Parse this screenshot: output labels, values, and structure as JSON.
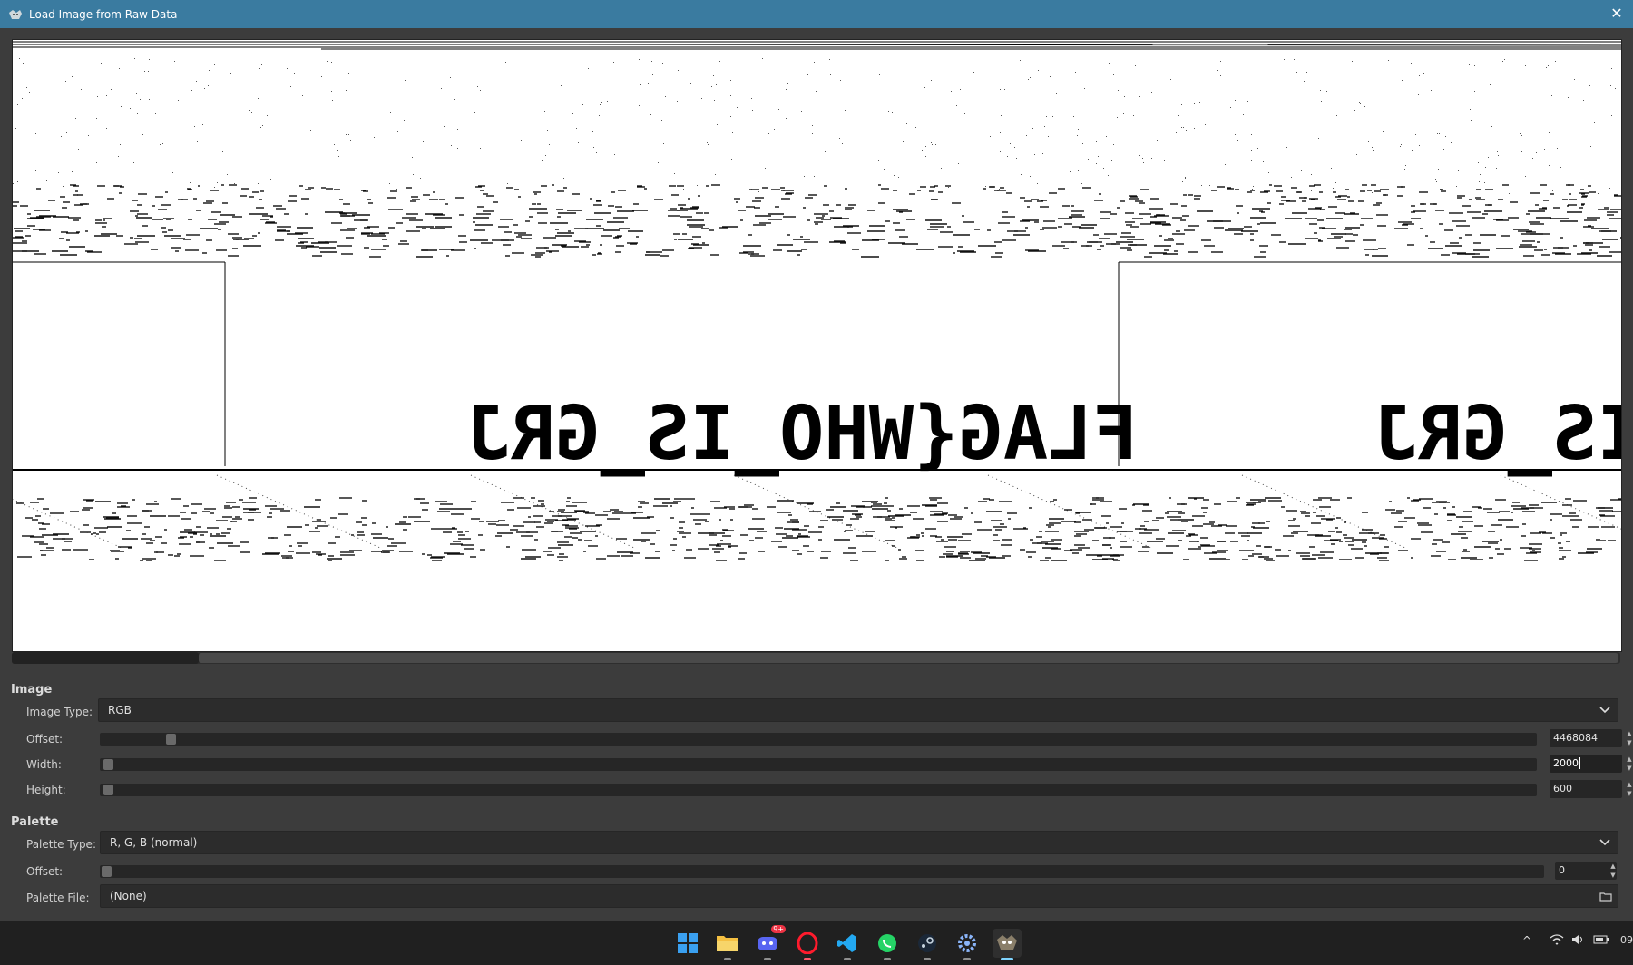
{
  "window": {
    "title": "Load Image from Raw Data",
    "close_glyph": "✕"
  },
  "preview": {
    "visible_text": "FLAG{WHO_IS_GRJ",
    "text_rendering": "mirrored garbled raw pixel data"
  },
  "image_section": {
    "heading": "Image",
    "image_type_label": "Image Type:",
    "image_type_value": "RGB",
    "offset_label": "Offset:",
    "offset_value": "4468084",
    "offset_level": 0.045,
    "width_label": "Width:",
    "width_value": "2000",
    "width_level": 0.001,
    "height_label": "Height:",
    "height_value": "600",
    "height_level": 0.001
  },
  "palette_section": {
    "heading": "Palette",
    "palette_type_label": "Palette Type:",
    "palette_type_value": "R, G, B (normal)",
    "offset_label": "Offset:",
    "offset_value": "0",
    "offset_level": 0.0,
    "palette_file_label": "Palette File:",
    "palette_file_value": "(None)"
  },
  "taskbar": {
    "apps": [
      "windows-start",
      "file-explorer",
      "discord",
      "opera",
      "vscode",
      "whatsapp",
      "steam",
      "settings",
      "gimp"
    ],
    "discord_badge": "9+",
    "clock_partial": "09"
  },
  "colors": {
    "titlebar": "#3a7ba0",
    "dialog_bg": "#3c3c3c",
    "taskbar_bg": "#202020"
  }
}
